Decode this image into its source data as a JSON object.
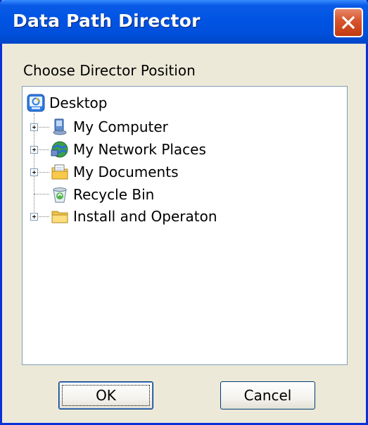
{
  "window": {
    "title": "Data Path Director"
  },
  "prompt": "Choose Director Position",
  "tree": {
    "root": {
      "label": "Desktop",
      "icon": "desktop-icon"
    },
    "items": [
      {
        "label": "My Computer",
        "icon": "my-computer-icon",
        "expandable": true
      },
      {
        "label": "My Network Places",
        "icon": "network-places-icon",
        "expandable": true
      },
      {
        "label": "My Documents",
        "icon": "my-documents-icon",
        "expandable": true
      },
      {
        "label": "Recycle Bin",
        "icon": "recycle-bin-icon",
        "expandable": false
      },
      {
        "label": "Install and Operaton",
        "icon": "folder-icon",
        "expandable": true
      }
    ]
  },
  "buttons": {
    "ok": "OK",
    "cancel": "Cancel"
  },
  "colors": {
    "titlebar": "#0054E3",
    "close": "#D8562E",
    "dialog_bg": "#ECE9D8"
  }
}
